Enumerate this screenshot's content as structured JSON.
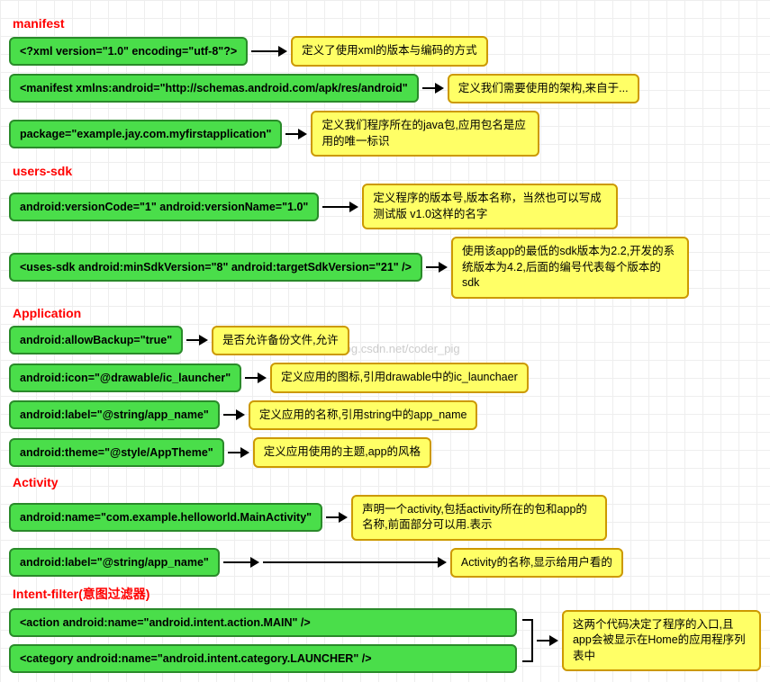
{
  "sections": {
    "manifest": "manifest",
    "users_sdk": "users-sdk",
    "application": "Application",
    "activity": "Activity",
    "intent_filter": "Intent-filter(意图过滤器)"
  },
  "manifest": {
    "xml_decl": "<?xml version=\"1.0\" encoding=\"utf-8\"?>",
    "xml_decl_desc": "定义了使用xml的版本与编码的方式",
    "manifest_tag": "<manifest xmlns:android=\"http://schemas.android.com/apk/res/android\"",
    "manifest_tag_desc": "定义我们需要使用的架构,来自于...",
    "package": "package=\"example.jay.com.myfirstapplication\"",
    "package_desc": "定义我们程序所在的java包,应用包名是应用的唯一标识"
  },
  "users_sdk": {
    "version": "android:versionCode=\"1\"    android:versionName=\"1.0\"",
    "version_desc": "定义程序的版本号,版本名称，当然也可以写成测试版 v1.0这样的名字",
    "uses_sdk": "<uses-sdk  android:minSdkVersion=\"8\"  android:targetSdkVersion=\"21\" />",
    "uses_sdk_desc": "使用该app的最低的sdk版本为2.2,开发的系统版本为4.2,后面的编号代表每个版本的sdk"
  },
  "application": {
    "allow_backup": "android:allowBackup=\"true\"",
    "allow_backup_desc": "是否允许备份文件,允许",
    "icon": "android:icon=\"@drawable/ic_launcher\"",
    "icon_desc": "定义应用的图标,引用drawable中的ic_launchaer",
    "label": "android:label=\"@string/app_name\"",
    "label_desc": "定义应用的名称,引用string中的app_name",
    "theme": "android:theme=\"@style/AppTheme\"",
    "theme_desc": "定义应用使用的主题,app的风格"
  },
  "activity": {
    "name": "android:name=\"com.example.helloworld.MainActivity\"",
    "name_desc": "声明一个activity,包括activity所在的包和app的名称,前面部分可以用.表示",
    "label": "android:label=\"@string/app_name\"",
    "label_desc": "Activity的名称,显示给用户看的"
  },
  "intent_filter": {
    "action": "<action android:name=\"android.intent.action.MAIN\" />",
    "category": "<category android:name=\"android.intent.category.LAUNCHER\" />",
    "desc": "这两个代码决定了程序的入口,且app会被显示在Home的应用程序列表中"
  },
  "watermark": "http://blog.csdn.net/coder_pig"
}
